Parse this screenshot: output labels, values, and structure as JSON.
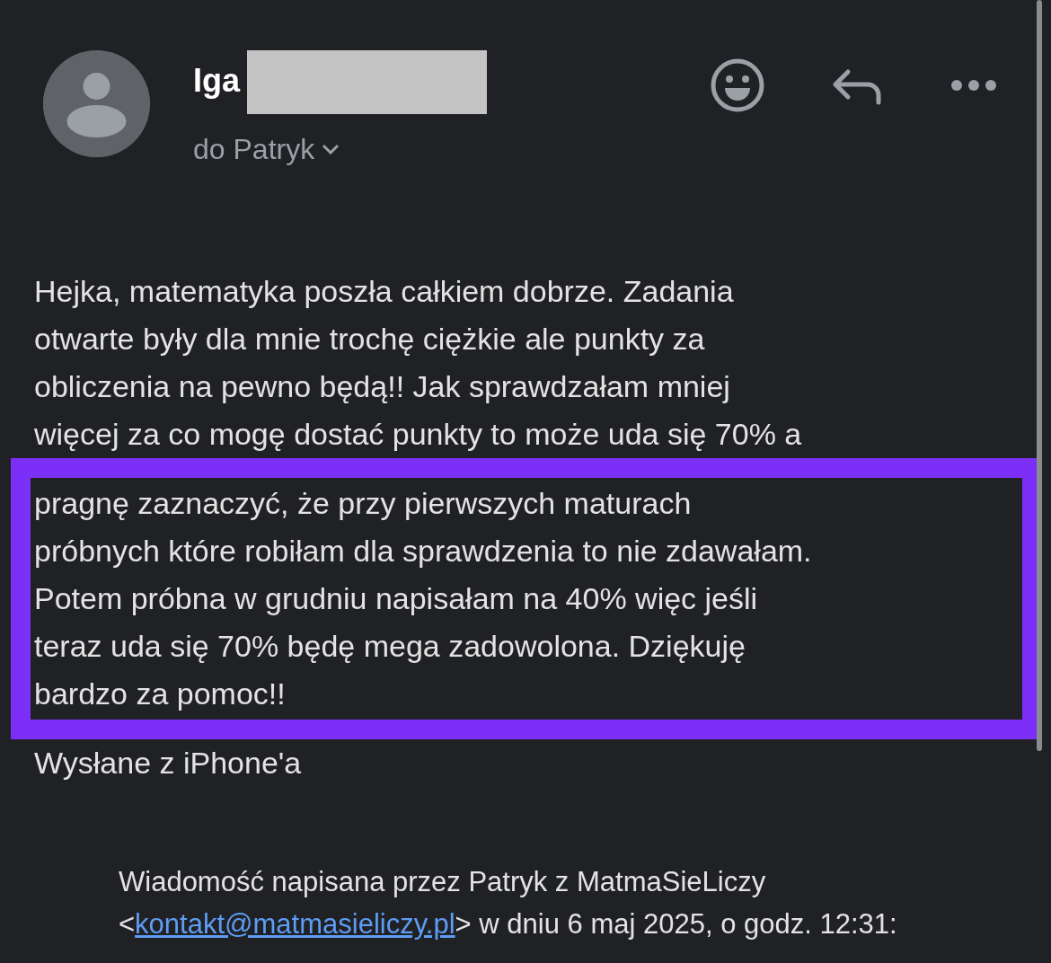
{
  "sender": {
    "name": "Iga",
    "redacted": true,
    "recipient": "do Patryk"
  },
  "body": {
    "lines": [
      "Hejka, matematyka poszła całkiem dobrze. Zadania",
      "otwarte były dla mnie trochę ciężkie ale punkty za",
      "obliczenia na pewno będą!! Jak sprawdzałam mniej",
      "więcej za co mogę dostać punkty to może uda się 70% a"
    ],
    "highlighted_lines": [
      "pragnę zaznaczyć, że przy pierwszych maturach",
      "próbnych które robiłam dla sprawdzenia to nie zdawałam.",
      "Potem próbna w grudniu napisałam na 40% więc jeśli",
      "teraz uda się 70% będę mega zadowolona. Dziękuję",
      "bardzo za pomoc!!"
    ],
    "signature": "Wysłane z iPhone'a"
  },
  "quote_header": {
    "before": "Wiadomość napisana przez Patryk z MatmaSieLiczy <",
    "link": "kontakt@matmasieliczy.pl",
    "after": "> w dniu 6 maj 2025, o godz. 12:31:"
  }
}
